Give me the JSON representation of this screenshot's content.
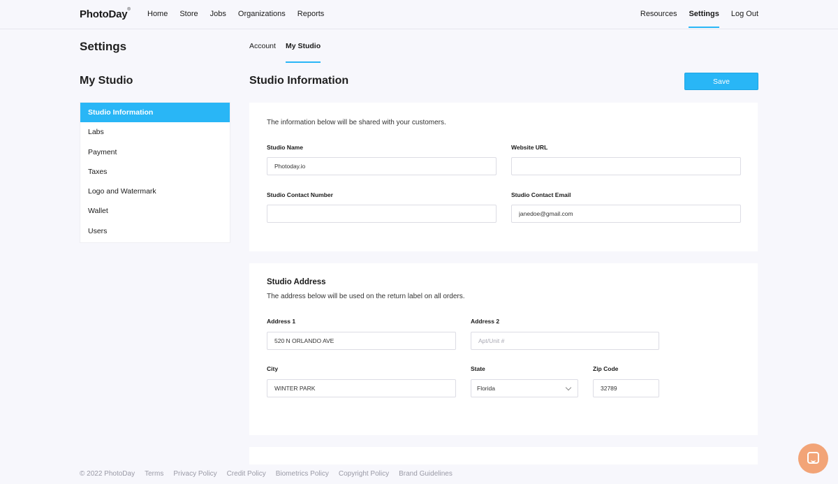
{
  "header": {
    "logo": "PhotoDay",
    "logo_mark": "®",
    "nav_left": [
      "Home",
      "Store",
      "Jobs",
      "Organizations",
      "Reports"
    ],
    "nav_right": {
      "resources": "Resources",
      "settings": "Settings",
      "logout": "Log Out"
    }
  },
  "page": {
    "title": "Settings",
    "tabs": {
      "account": "Account",
      "my_studio": "My Studio"
    }
  },
  "sidebar": {
    "title": "My Studio",
    "items": [
      "Studio Information",
      "Labs",
      "Payment",
      "Taxes",
      "Logo and Watermark",
      "Wallet",
      "Users"
    ]
  },
  "main": {
    "title": "Studio Information",
    "save_label": "Save",
    "info_card": {
      "intro": "The information below will be shared with your customers.",
      "studio_name_label": "Studio Name",
      "studio_name_value": "Photoday.io",
      "website_label": "Website URL",
      "website_value": "",
      "contact_number_label": "Studio Contact Number",
      "contact_number_value": "",
      "contact_email_label": "Studio Contact Email",
      "contact_email_value": "janedoe@gmail.com"
    },
    "address_card": {
      "heading": "Studio Address",
      "intro": "The address below will be used on the return label on all orders.",
      "address1_label": "Address 1",
      "address1_value": "520 N ORLANDO AVE",
      "address2_label": "Address 2",
      "address2_placeholder": "Apt/Unit #",
      "city_label": "City",
      "city_value": "WINTER PARK",
      "state_label": "State",
      "state_value": "Florida",
      "zip_label": "Zip Code",
      "zip_value": "32789"
    }
  },
  "footer": {
    "copyright": "© 2022 PhotoDay",
    "links": [
      "Terms",
      "Privacy Policy",
      "Credit Policy",
      "Biometrics Policy",
      "Copyright Policy",
      "Brand Guidelines"
    ]
  },
  "colors": {
    "accent": "#29b6f6",
    "chat": "#f2a477",
    "background": "#f7f7fc"
  }
}
